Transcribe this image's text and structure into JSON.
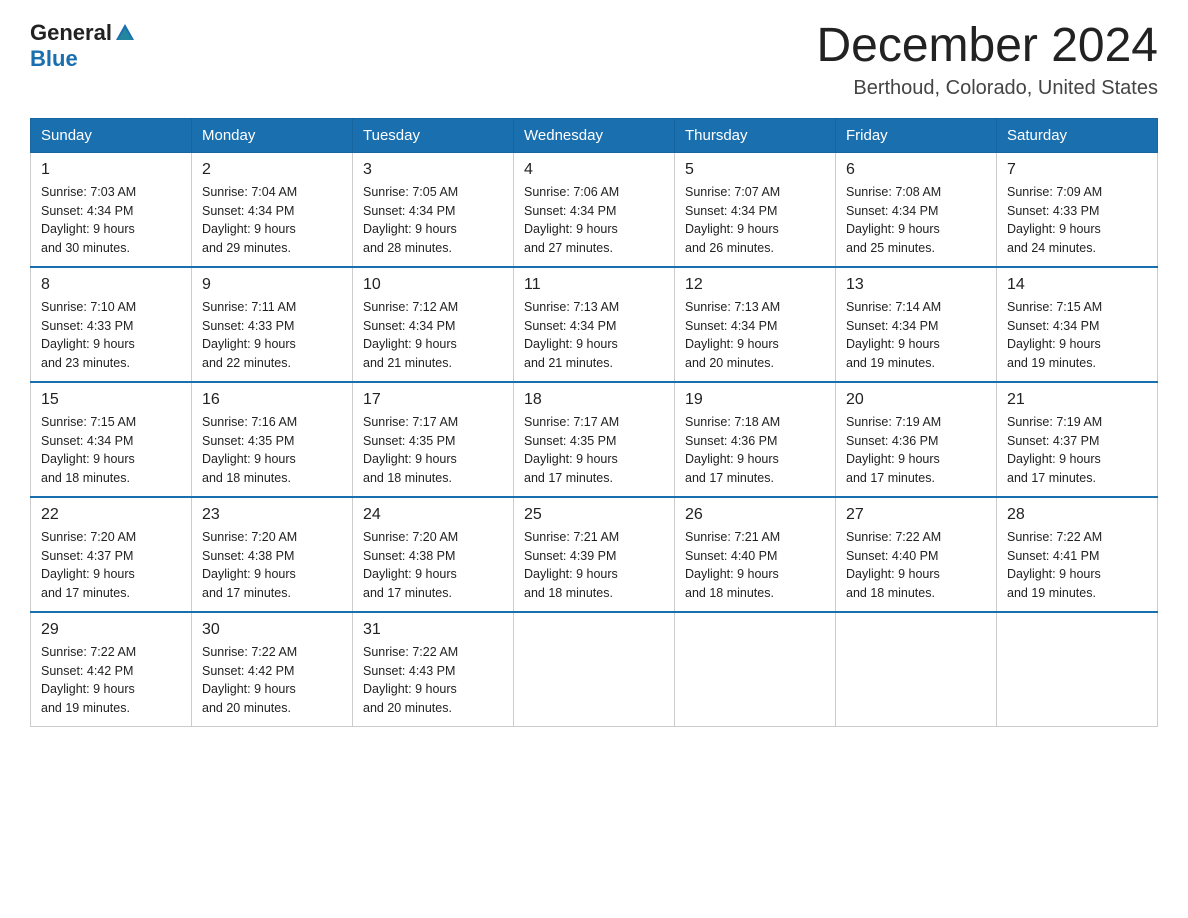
{
  "header": {
    "logo_general": "General",
    "logo_blue": "Blue",
    "month_title": "December 2024",
    "location": "Berthoud, Colorado, United States"
  },
  "weekdays": [
    "Sunday",
    "Monday",
    "Tuesday",
    "Wednesday",
    "Thursday",
    "Friday",
    "Saturday"
  ],
  "weeks": [
    [
      {
        "day": "1",
        "sunrise": "7:03 AM",
        "sunset": "4:34 PM",
        "daylight": "9 hours and 30 minutes."
      },
      {
        "day": "2",
        "sunrise": "7:04 AM",
        "sunset": "4:34 PM",
        "daylight": "9 hours and 29 minutes."
      },
      {
        "day": "3",
        "sunrise": "7:05 AM",
        "sunset": "4:34 PM",
        "daylight": "9 hours and 28 minutes."
      },
      {
        "day": "4",
        "sunrise": "7:06 AM",
        "sunset": "4:34 PM",
        "daylight": "9 hours and 27 minutes."
      },
      {
        "day": "5",
        "sunrise": "7:07 AM",
        "sunset": "4:34 PM",
        "daylight": "9 hours and 26 minutes."
      },
      {
        "day": "6",
        "sunrise": "7:08 AM",
        "sunset": "4:34 PM",
        "daylight": "9 hours and 25 minutes."
      },
      {
        "day": "7",
        "sunrise": "7:09 AM",
        "sunset": "4:33 PM",
        "daylight": "9 hours and 24 minutes."
      }
    ],
    [
      {
        "day": "8",
        "sunrise": "7:10 AM",
        "sunset": "4:33 PM",
        "daylight": "9 hours and 23 minutes."
      },
      {
        "day": "9",
        "sunrise": "7:11 AM",
        "sunset": "4:33 PM",
        "daylight": "9 hours and 22 minutes."
      },
      {
        "day": "10",
        "sunrise": "7:12 AM",
        "sunset": "4:34 PM",
        "daylight": "9 hours and 21 minutes."
      },
      {
        "day": "11",
        "sunrise": "7:13 AM",
        "sunset": "4:34 PM",
        "daylight": "9 hours and 21 minutes."
      },
      {
        "day": "12",
        "sunrise": "7:13 AM",
        "sunset": "4:34 PM",
        "daylight": "9 hours and 20 minutes."
      },
      {
        "day": "13",
        "sunrise": "7:14 AM",
        "sunset": "4:34 PM",
        "daylight": "9 hours and 19 minutes."
      },
      {
        "day": "14",
        "sunrise": "7:15 AM",
        "sunset": "4:34 PM",
        "daylight": "9 hours and 19 minutes."
      }
    ],
    [
      {
        "day": "15",
        "sunrise": "7:15 AM",
        "sunset": "4:34 PM",
        "daylight": "9 hours and 18 minutes."
      },
      {
        "day": "16",
        "sunrise": "7:16 AM",
        "sunset": "4:35 PM",
        "daylight": "9 hours and 18 minutes."
      },
      {
        "day": "17",
        "sunrise": "7:17 AM",
        "sunset": "4:35 PM",
        "daylight": "9 hours and 18 minutes."
      },
      {
        "day": "18",
        "sunrise": "7:17 AM",
        "sunset": "4:35 PM",
        "daylight": "9 hours and 17 minutes."
      },
      {
        "day": "19",
        "sunrise": "7:18 AM",
        "sunset": "4:36 PM",
        "daylight": "9 hours and 17 minutes."
      },
      {
        "day": "20",
        "sunrise": "7:19 AM",
        "sunset": "4:36 PM",
        "daylight": "9 hours and 17 minutes."
      },
      {
        "day": "21",
        "sunrise": "7:19 AM",
        "sunset": "4:37 PM",
        "daylight": "9 hours and 17 minutes."
      }
    ],
    [
      {
        "day": "22",
        "sunrise": "7:20 AM",
        "sunset": "4:37 PM",
        "daylight": "9 hours and 17 minutes."
      },
      {
        "day": "23",
        "sunrise": "7:20 AM",
        "sunset": "4:38 PM",
        "daylight": "9 hours and 17 minutes."
      },
      {
        "day": "24",
        "sunrise": "7:20 AM",
        "sunset": "4:38 PM",
        "daylight": "9 hours and 17 minutes."
      },
      {
        "day": "25",
        "sunrise": "7:21 AM",
        "sunset": "4:39 PM",
        "daylight": "9 hours and 18 minutes."
      },
      {
        "day": "26",
        "sunrise": "7:21 AM",
        "sunset": "4:40 PM",
        "daylight": "9 hours and 18 minutes."
      },
      {
        "day": "27",
        "sunrise": "7:22 AM",
        "sunset": "4:40 PM",
        "daylight": "9 hours and 18 minutes."
      },
      {
        "day": "28",
        "sunrise": "7:22 AM",
        "sunset": "4:41 PM",
        "daylight": "9 hours and 19 minutes."
      }
    ],
    [
      {
        "day": "29",
        "sunrise": "7:22 AM",
        "sunset": "4:42 PM",
        "daylight": "9 hours and 19 minutes."
      },
      {
        "day": "30",
        "sunrise": "7:22 AM",
        "sunset": "4:42 PM",
        "daylight": "9 hours and 20 minutes."
      },
      {
        "day": "31",
        "sunrise": "7:22 AM",
        "sunset": "4:43 PM",
        "daylight": "9 hours and 20 minutes."
      },
      null,
      null,
      null,
      null
    ]
  ],
  "labels": {
    "sunrise": "Sunrise:",
    "sunset": "Sunset:",
    "daylight": "Daylight:"
  }
}
